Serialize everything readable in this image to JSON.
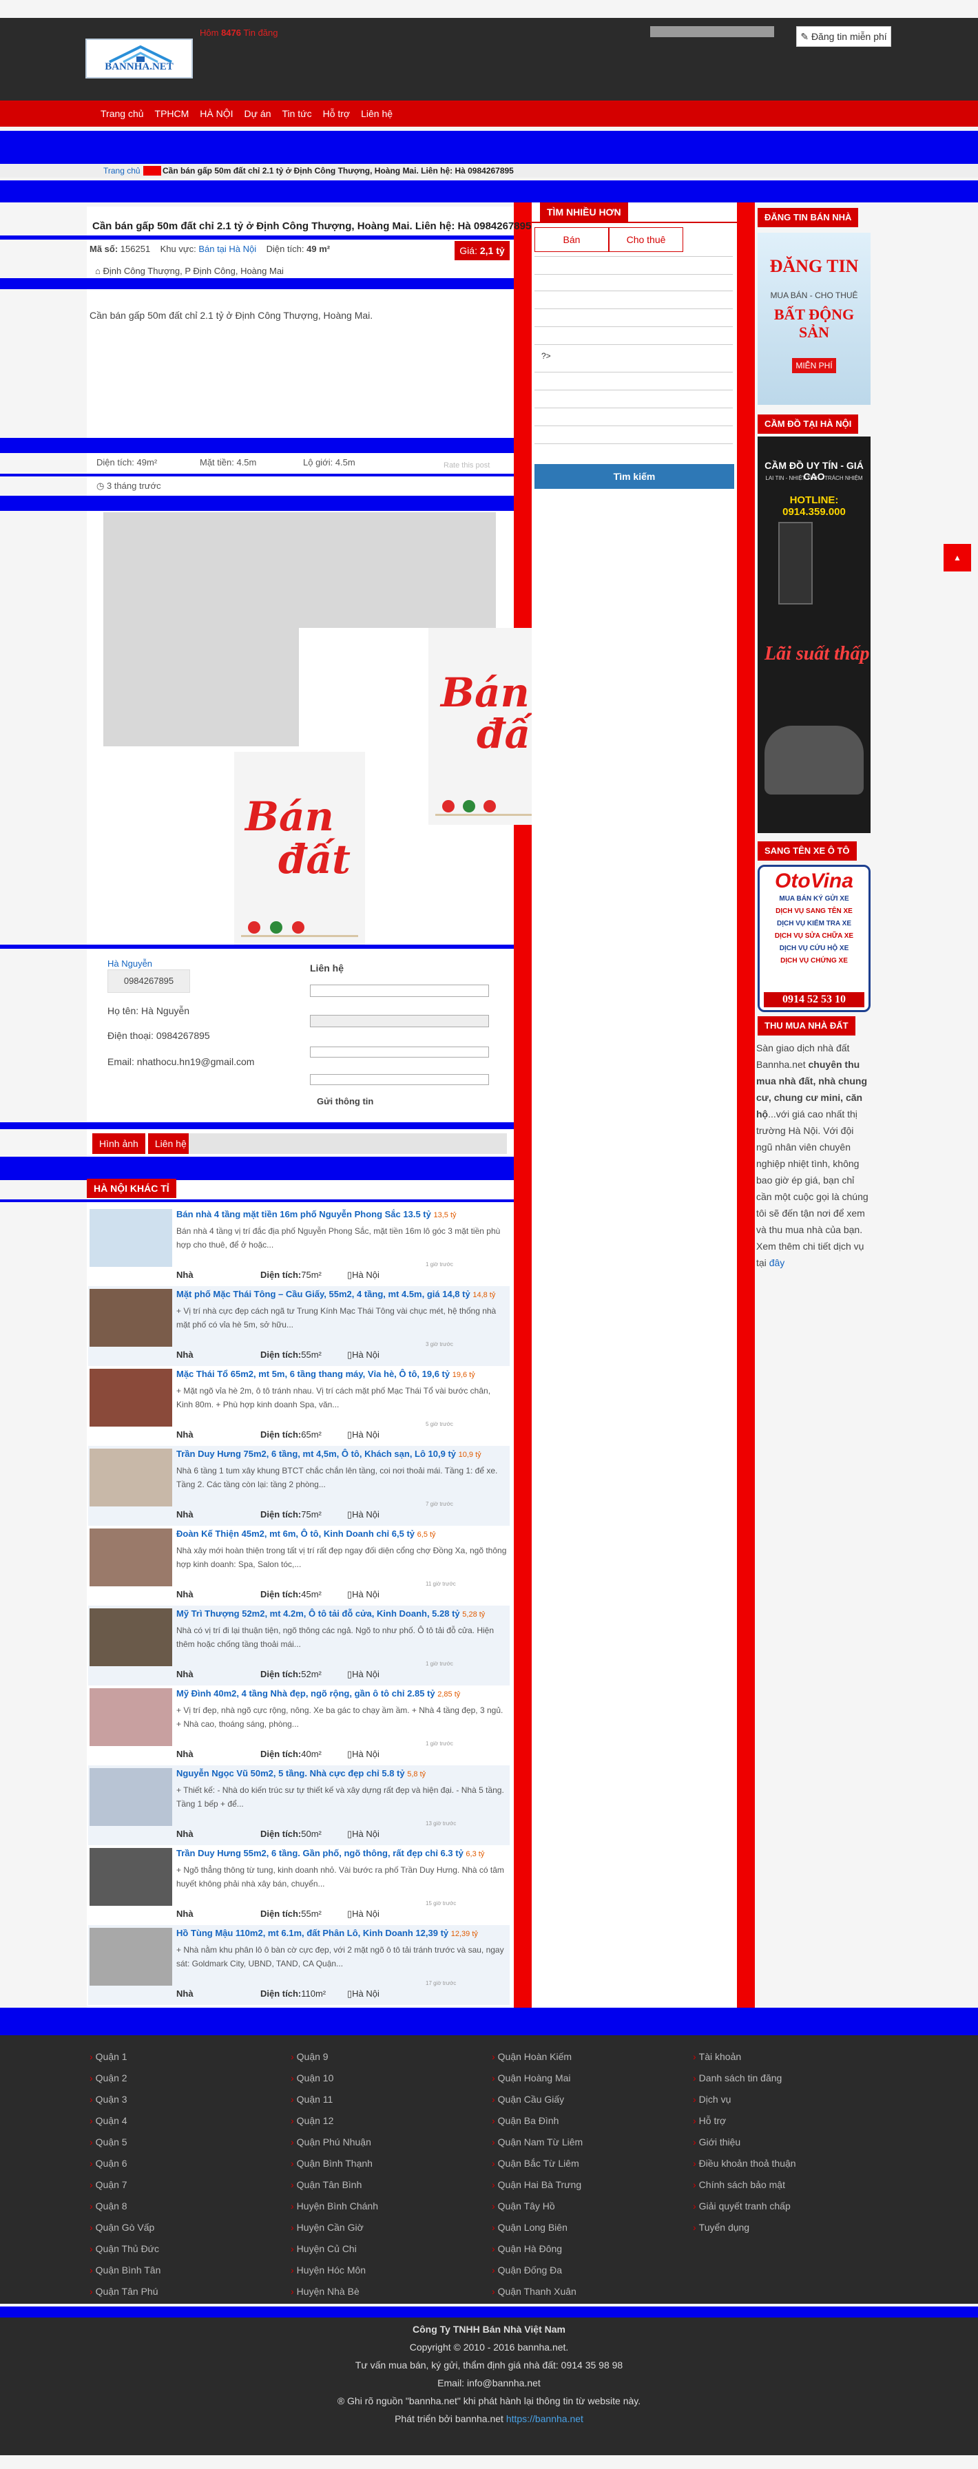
{
  "header": {
    "logo_text": "BANNHA.NET",
    "hotline_label": "Hôm",
    "hotline_count": "8476",
    "hotline_suffix": "Tin đăng",
    "post_button": "Đăng tin miễn phí"
  },
  "nav": [
    "Trang chủ",
    "TPHCM",
    "HÀ NỘI",
    "Dự án",
    "Tin tức",
    "Hỗ trợ",
    "Liên hệ"
  ],
  "breadcrumb": {
    "home": "Trang chủ",
    "current": "Cần bán gấp 50m đất chỉ 2.1 tỷ ở Định Công Thượng, Hoàng Mai. Liên hệ: Hà 0984267895"
  },
  "listing": {
    "title": "Cần bán gấp 50m đất chỉ 2.1 tỷ ở Định Công Thượng, Hoàng Mai. Liên hệ: Hà 0984267895",
    "code_label": "Mã số:",
    "code": "156251",
    "area_label": "Khu vực:",
    "area": "Bán tại Hà Nội",
    "size_label": "Diện tích:",
    "size": "49 m²",
    "price_label": "Giá:",
    "price": "2,1 tỷ",
    "address": "Định Công Thượng, P Định Công, Hoàng Mai",
    "description": "Cần bán gấp 50m đất chỉ 2.1 tỷ ở Định Công Thượng, Hoàng Mai.",
    "spec_area": "Diện tích: 49m²",
    "spec_front": "Mặt tiền: 4.5m",
    "spec_lane": "Lộ giới: 4.5m",
    "rating": "Rate this post",
    "age": "3 tháng trước",
    "sign_word1": "Bán",
    "sign_word2": "đất"
  },
  "contact": {
    "agent_link": "Hà Nguyễn",
    "phone_badge": "0984267895",
    "name_label": "Họ tên: Hà Nguyễn",
    "phone_label": "Điện thoại: 0984267895",
    "email_label": "Email: nhathocu.hn19@gmail.com",
    "form_title": "Liên hệ",
    "submit": "Gửi thông tin"
  },
  "tabs": [
    "Hình ảnh",
    "Liên hệ"
  ],
  "other_section_title": "HÀ NỘI KHÁC TỈ",
  "items": [
    {
      "title": "Bán nhà 4 tầng mặt tiền 16m phố Nguyễn Phong Sắc 13.5 tỷ",
      "price": "13,5 tỷ",
      "desc": "Bán nhà 4 tầng vị trí đắc địa phố Nguyễn Phong Sắc, mặt tiền 16m lô góc 3 mặt tiền phù hợp cho thuê, để ở hoặc...",
      "type": "Nhà",
      "area": "75m²",
      "city": "Hà Nội",
      "time": "1 giờ trước"
    },
    {
      "title": "Mặt phố Mặc Thái Tông – Cầu Giấy, 55m2, 4 tầng, mt 4.5m, giá 14,8 tỷ",
      "price": "14,8 tỷ",
      "desc": "+ Vị trí nhà cực đẹp cách ngã tư Trung Kính Mạc Thái Tông vài chục mét, hệ thống nhà mặt phố có vỉa hè 5m, sở hữu...",
      "type": "Nhà",
      "area": "55m²",
      "city": "Hà Nội",
      "time": "3 giờ trước"
    },
    {
      "title": "Mặc Thái Tổ 65m2, mt 5m, 6 tầng thang máy, Vỉa hè, Ô tô, 19,6 tỷ",
      "price": "19,6 tỷ",
      "desc": "+ Mặt ngõ vỉa hè 2m, ô tô tránh nhau. Vị trí cách mặt phố Mạc Thái Tổ vài bước chân, Kinh 80m. + Phù hợp kinh doanh Spa, văn...",
      "type": "Nhà",
      "area": "65m²",
      "city": "Hà Nội",
      "time": "5 giờ trước"
    },
    {
      "title": "Trần Duy Hưng 75m2, 6 tầng, mt 4,5m, Ô tô, Khách sạn, Lô 10,9 tỷ",
      "price": "10,9 tỷ",
      "desc": "Nhà 6 tầng 1 tum xây khung BTCT chắc chắn lên tầng, coi nơi thoải mái. Tầng 1: để xe. Tầng 2. Các tầng còn lại: tầng 2 phòng...",
      "type": "Nhà",
      "area": "75m²",
      "city": "Hà Nội",
      "time": "7 giờ trước"
    },
    {
      "title": "Đoàn Kế Thiện 45m2, mt 6m, Ô tô, Kinh Doanh chỉ 6,5 tỷ",
      "price": "6,5 tỷ",
      "desc": "Nhà xây mới hoàn thiện trong tất vị trí rất đẹp ngay đối diện cổng chợ Đồng Xa, ngõ thông hợp kinh doanh: Spa, Salon tóc,...",
      "type": "Nhà",
      "area": "45m²",
      "city": "Hà Nội",
      "time": "11 giờ trước"
    },
    {
      "title": "Mỹ Trì Thượng 52m2, mt 4.2m, Ô tô tải đỗ cửa, Kinh Doanh, 5.28 tỷ",
      "price": "5,28 tỷ",
      "desc": "Nhà có vị trí đi lại thuận tiện, ngõ thông các ngả. Ngõ to như phố. Ô tô tải đỗ cửa. Hiện thêm hoặc chống tầng thoải mái...",
      "type": "Nhà",
      "area": "52m²",
      "city": "Hà Nội",
      "time": "1 giờ trước"
    },
    {
      "title": "Mỹ Đình 40m2, 4 tầng Nhà đẹp, ngõ rộng, gần ô tô chỉ 2.85 tỷ",
      "price": "2,85 tỷ",
      "desc": "+ Vị trí đẹp, nhà ngõ cực rộng, nông. Xe ba gác to chạy ầm ầm. + Nhà 4 tầng đẹp, 3 ngủ. + Nhà cao, thoáng sáng, phòng...",
      "type": "Nhà",
      "area": "40m²",
      "city": "Hà Nội",
      "time": "1 giờ trước"
    },
    {
      "title": "Nguyễn Ngọc Vũ 50m2, 5 tầng. Nhà cực đẹp chỉ 5.8 tỷ",
      "price": "5,8 tỷ",
      "desc": "+ Thiết kế: - Nhà do kiến trúc sư tự thiết kế và xây dựng rất đẹp và hiện đại. - Nhà 5 tầng. Tầng 1 bếp + để...",
      "type": "Nhà",
      "area": "50m²",
      "city": "Hà Nội",
      "time": "13 giờ trước"
    },
    {
      "title": "Trần Duy Hưng 55m2, 6 tầng. Gần phố, ngõ thông, rất đẹp chỉ 6.3 tỷ",
      "price": "6,3 tỷ",
      "desc": "+ Ngõ thẳng thông từ tung, kinh doanh nhỏ. Vài bước ra phố Trần Duy Hưng. Nhà có tâm huyết không phải nhà xây bán, chuyển...",
      "type": "Nhà",
      "area": "55m²",
      "city": "Hà Nội",
      "time": "15 giờ trước"
    },
    {
      "title": "Hồ Tùng Mậu 110m2, mt 6.1m, đất Phân Lô, Kinh Doanh 12,39 tỷ",
      "price": "12,39 tỷ",
      "desc": "+ Nhà nằm khu phân lô ô bàn cờ cực đẹp, với 2 mặt ngõ ô tô tải tránh trước và sau, ngay sát: Goldmark City, UBND, TAND, CA Quận...",
      "type": "Nhà",
      "area": "110m²",
      "city": "Hà Nội",
      "time": "17 giờ trước"
    }
  ],
  "item_area_label": "Diện tích:",
  "search": {
    "title": "TÌM NHIỀU HƠN",
    "tab_sale": "Bán",
    "tab_rent": "Cho thuê",
    "question": "?>",
    "button": "Tìm kiếm"
  },
  "sidebar": {
    "ad1_head": "ĐĂNG TIN BÁN NHÀ",
    "ad1_big1": "ĐĂNG TIN",
    "ad1_small": "MUA BÁN - CHO THUÊ",
    "ad1_big2": "BẤT ĐỘNG SẢN",
    "ad1_free": "MIỄN PHÍ",
    "ad2_head": "CẦM ĐỒ TẠI HÀ NỘI",
    "ad2_line1": "CẦM ĐỒ UY TÍN - GIÁ CAO",
    "ad2_line2": "LAI TIN - NHIỆT TÌNH - TRÁCH NHIỆM",
    "ad2_hotline": "HOTLINE: 0914.359.000",
    "ad2_rate": "Lãi suất thấp",
    "ad3_head": "SANG TÊN XE Ô TÔ",
    "ad3_brand": "OtoVina",
    "ad3_lines": [
      "MUA BÁN KÝ GỬI XE",
      "DỊCH VỤ SANG TÊN XE",
      "DỊCH VỤ KIỂM TRA XE",
      "DỊCH VỤ SỬA CHỮA XE",
      "DỊCH VỤ CỨU HỘ XE",
      "DỊCH VỤ CHỨNG XE"
    ],
    "ad3_phone": "0914 52 53 10",
    "ad4_head": "THU MUA NHÀ ĐẤT",
    "text_intro": "Sàn giao dịch nhà đất Bannha.net",
    "text_bold": "chuyên thu mua nhà đất, nhà chung cư, chung cư mini, căn hộ",
    "text_rest": "...với giá cao nhất thị trường Hà Nội. Với đội ngũ nhân viên chuyên nghiệp nhiệt tình, không bao giờ ép giá, bạn chỉ cần một cuộc gọi là chúng tôi sẽ đến tận nơi để xem và thu mua nhà của bạn. Xem thêm chi tiết dịch vụ tại",
    "text_link": "đây"
  },
  "footer": {
    "col1": [
      "Quận 1",
      "Quận 2",
      "Quận 3",
      "Quận 4",
      "Quận 5",
      "Quận 6",
      "Quận 7",
      "Quận 8",
      "Quận Gò Vấp",
      "Quận Thủ Đức",
      "Quận Bình Tân",
      "Quận Tân Phú"
    ],
    "col2": [
      "Quận 9",
      "Quận 10",
      "Quận 11",
      "Quận 12",
      "Quận Phú Nhuận",
      "Quận Bình Thạnh",
      "Quận Tân Bình",
      "Huyện Bình Chánh",
      "Huyện Cần Giờ",
      "Huyện Củ Chi",
      "Huyện Hóc Môn",
      "Huyện Nhà Bè"
    ],
    "col3": [
      "Quận Hoàn Kiếm",
      "Quận Hoàng Mai",
      "Quận Cầu Giấy",
      "Quận Ba Đình",
      "Quận Nam Từ Liêm",
      "Quận Bắc Từ Liêm",
      "Quận Hai Bà Trưng",
      "Quận Tây Hồ",
      "Quận Long Biên",
      "Quận Hà Đông",
      "Quận Đống Đa",
      "Quận Thanh Xuân"
    ],
    "col4": [
      "Tài khoản",
      "Danh sách tin đăng",
      "Dịch vụ",
      "Hỗ trợ",
      "Giới thiệu",
      "Điều khoản thoả thuận",
      "Chính sách bảo mật",
      "Giải quyết tranh chấp",
      "Tuyển dụng"
    ],
    "company": "Công Ty TNHH Bán Nhà Việt Nam",
    "copyright": "Copyright © 2010 - 2016 bannha.net.",
    "consult": "Tư vấn mua bán, ký gửi, thẩm định giá nhà đất: 0914 35 98 98",
    "email": "Email: info@bannha.net",
    "note": "® Ghi rõ nguồn \"bannha.net\" khi phát hành lại thông tin từ website này.",
    "dev_prefix": "Phát triển bởi bannha.net",
    "dev_link": "https://bannha.net"
  }
}
